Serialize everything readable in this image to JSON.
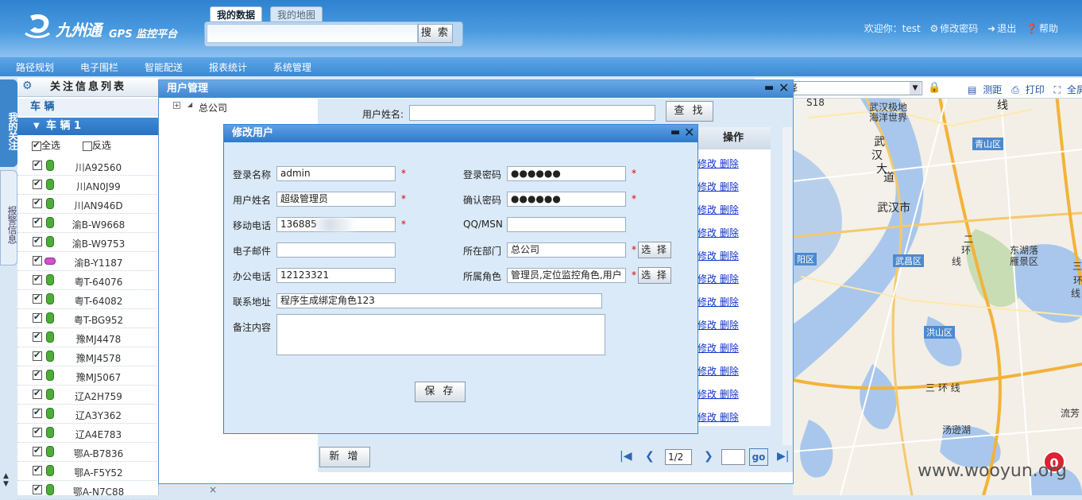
{
  "header": {
    "logo_text": "九州通",
    "logo_sub": "GPS 监控平台",
    "tabs": [
      "我的数据",
      "我的地图"
    ],
    "search_button": "搜 索",
    "welcome": "欢迎你：test",
    "change_password": "修改密码",
    "logout": "退出",
    "help": "帮助"
  },
  "nav": [
    "路径规划",
    "电子围栏",
    "智能配送",
    "报表统计",
    "系统管理"
  ],
  "side_tabs": {
    "my_follow": "我的关注",
    "alarm_info": "报警信息"
  },
  "sidebar": {
    "title": "关注信息列表",
    "section": "车 辆",
    "group": "车 辆 1",
    "select_all": "全选",
    "invert": "反选",
    "vehicles": [
      "川A92560",
      "川AN0J99",
      "川AN946D",
      "渝B-W9668",
      "渝B-W9753",
      "渝B-Y1187",
      "粤T-64076",
      "粤T-64082",
      "粤T-BG952",
      "豫MJ4478",
      "豫MJ4578",
      "豫MJ5067",
      "辽A2H759",
      "辽A3Y362",
      "辽A4E783",
      "鄂A-B7836",
      "鄂A-F5Y52",
      "鄂A-N7C88"
    ],
    "close": "×"
  },
  "map": {
    "select_placeholder": "请选择",
    "tools": [
      "测距",
      "打印",
      "全屏"
    ],
    "labels": [
      "武汉极地",
      "海洋世界",
      "武",
      "汉",
      "大",
      "道",
      "青山区",
      "武汉市",
      "东湖落",
      "雁景区",
      "武昌区",
      "二",
      "环",
      "线",
      "三",
      "环",
      "线",
      "洪山区",
      "三 环 线",
      "汤逊湖",
      "流芳",
      "阳区",
      "S18",
      "线"
    ],
    "badge": "0",
    "watermark": "www.wooyun.org"
  },
  "user_window": {
    "title": "用户管理",
    "tree_root": "总公司",
    "username_label": "用户姓名:",
    "find_button": "查 找",
    "ops_header": "操作",
    "op_edit": "修改",
    "op_delete": "删除",
    "add_button": "新 增",
    "page": "1/2",
    "go": "go"
  },
  "edit_dialog": {
    "title": "修改用户",
    "fields": {
      "login_name": {
        "label": "登录名称",
        "value": "admin"
      },
      "login_password": {
        "label": "登录密码",
        "value": "●●●●●●"
      },
      "user_name": {
        "label": "用户姓名",
        "value": "超级管理员"
      },
      "confirm_password": {
        "label": "确认密码",
        "value": "●●●●●●"
      },
      "mobile": {
        "label": "移动电话",
        "value": "136885"
      },
      "qq_msn": {
        "label": "QQ/MSN",
        "value": ""
      },
      "email": {
        "label": "电子邮件",
        "value": ""
      },
      "department": {
        "label": "所在部门",
        "value": "总公司"
      },
      "office_phone": {
        "label": "办公电话",
        "value": "12123321"
      },
      "role": {
        "label": "所属角色",
        "value": "管理员,定位监控角色,用户"
      },
      "address": {
        "label": "联系地址",
        "value": "程序生成绑定角色123"
      },
      "remarks": {
        "label": "备注内容",
        "value": ""
      }
    },
    "required_mark": "*",
    "choose_button": "选 择",
    "save_button": "保 存"
  }
}
